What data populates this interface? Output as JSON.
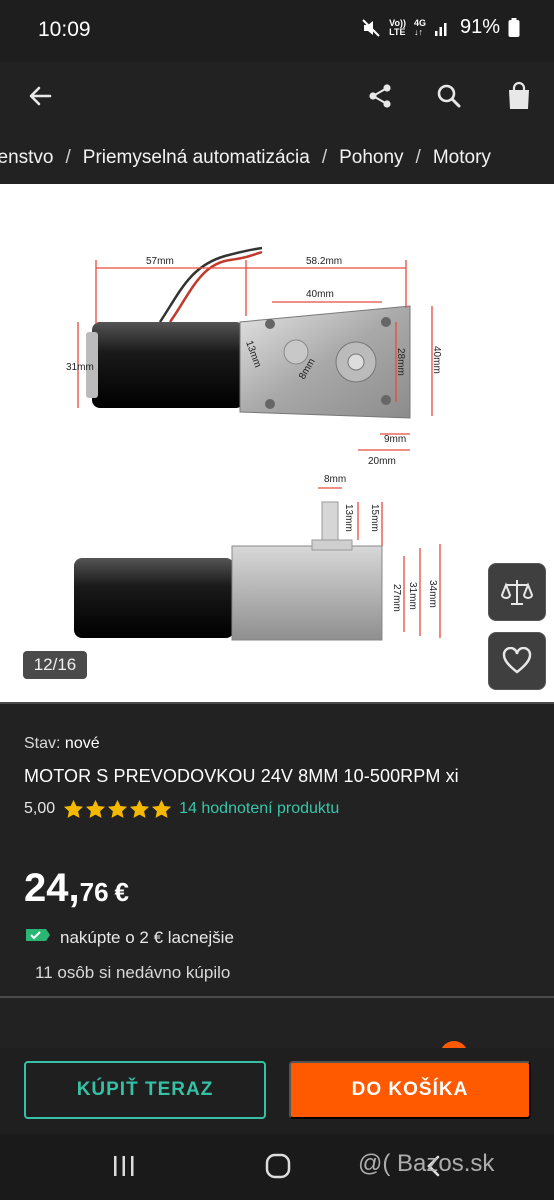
{
  "status_bar": {
    "time": "10:09",
    "net_top": "Vo))",
    "net_bottom": "LTE",
    "network_type": "4G",
    "battery": "91%",
    "icons": [
      "mute-icon",
      "signal-icon",
      "battery-icon"
    ]
  },
  "app_bar": {
    "icons": [
      "back-arrow-icon",
      "share-icon",
      "search-icon",
      "shopping-bag-icon"
    ]
  },
  "breadcrumb": {
    "items": [
      "šenstvo",
      "Priemyselná automatizácia",
      "Pohony",
      "Motory"
    ],
    "separator": "/"
  },
  "gallery": {
    "counter": "12/16",
    "side_buttons": [
      "compare-scale-icon",
      "heart-icon"
    ],
    "diagram_labels": {
      "top_57": "57mm",
      "top_582": "58.2mm",
      "top_40": "40mm",
      "left_31": "31mm",
      "bolt_13": "13mm",
      "bolt_8": "8mm",
      "right_28": "28mm",
      "right_40": "40mm",
      "bottom_9": "9mm",
      "bottom_20": "20mm",
      "shaft_8": "8mm",
      "shaft_13": "13mm",
      "shaft_15": "15mm",
      "side_27": "27mm",
      "side_31": "31mm",
      "side_34": "34mm"
    }
  },
  "product": {
    "condition_label": "Stav:",
    "condition_value": "nové",
    "title": "MOTOR S PREVODOVKOU 24V 8MM 10-500RPM xi",
    "rating_value": "5,00",
    "stars": 5,
    "rating_link": "14 hodnotení produktu",
    "price_main": "24,",
    "price_cents": "76",
    "currency": "€",
    "discount_text": "nakúpte o 2 € lacnejšie",
    "recent_buyers": "11 osôb si nedávno kúpilo"
  },
  "actions": {
    "buy_now": "KÚPIŤ TERAZ",
    "add_to_cart": "DO KOŠÍKA"
  },
  "nav_bar": {
    "icons": [
      "recents-icon",
      "home-icon",
      "back-icon"
    ]
  },
  "watermark": "@( Bazos.sk",
  "colors": {
    "accent_teal": "#35c1a4",
    "accent_orange": "#ff5a00",
    "star_yellow": "#f5b800",
    "background": "#222222"
  }
}
